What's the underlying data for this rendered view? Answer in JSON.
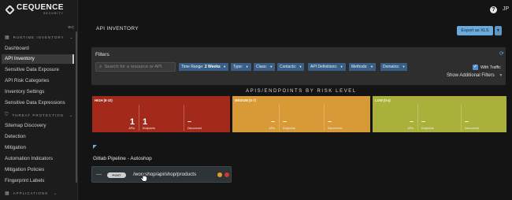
{
  "brand": {
    "name": "CEQUENCE",
    "sub": "SECURITY"
  },
  "sidebar": {
    "sections": [
      {
        "label": "RUNTIME INVENTORY"
      },
      {
        "label": "THREAT PROTECTION"
      },
      {
        "label": "APPLICATIONS"
      }
    ],
    "inventory_items": [
      {
        "label": "Dashboard"
      },
      {
        "label": "API Inventory",
        "active": true
      },
      {
        "label": "Sensitive Data Exposure"
      },
      {
        "label": "API Risk Categories"
      },
      {
        "label": "Inventory Settings"
      },
      {
        "label": "Sensitive Data Expressions"
      }
    ],
    "threat_items": [
      {
        "label": "Sitemap Discovery"
      },
      {
        "label": "Detection"
      },
      {
        "label": "Mitigation"
      },
      {
        "label": "Automation Indicators"
      },
      {
        "label": "Mitigation Policies"
      },
      {
        "label": "Fingerprint Labels"
      }
    ]
  },
  "header": {
    "user_initials": "JP",
    "help_glyph": "?"
  },
  "page": {
    "title": "API INVENTORY",
    "export_label": "Export as XLS"
  },
  "filters": {
    "title": "Filters",
    "search_placeholder": "Search for a resource or API",
    "chips": [
      {
        "label": "Time Range:",
        "value": "2 Weeks"
      },
      {
        "label": "Type:",
        "value": ""
      },
      {
        "label": "Class:",
        "value": ""
      },
      {
        "label": "Contacts:",
        "value": ""
      },
      {
        "label": "API Definitions:",
        "value": ""
      },
      {
        "label": "Methods:",
        "value": ""
      },
      {
        "label": "Domains:",
        "value": ""
      }
    ],
    "with_traffic_label": "With Traffic",
    "with_traffic_checked": true,
    "show_additional_label": "Show Additional Filters"
  },
  "risk": {
    "heading": "APIS/ENDPOINTS BY RISK LEVEL",
    "cards": [
      {
        "level": "high",
        "label": "HIGH (8-10)",
        "apis": "1",
        "endpoints": "1",
        "discovered": "–",
        "apis_label": "APIs",
        "endpoints_label": "Endpoints",
        "discovered_label": "Discovered"
      },
      {
        "level": "medium",
        "label": "MEDIUM (5-7)",
        "apis": "–",
        "endpoints": "–",
        "discovered": "–",
        "apis_label": "APIs",
        "endpoints_label": "Endpoints",
        "discovered_label": "Discovered"
      },
      {
        "level": "low",
        "label": "LOW (0-4)",
        "apis": "–",
        "endpoints": "–",
        "discovered": "–",
        "apis_label": "APIs",
        "endpoints_label": "Endpoints",
        "discovered_label": "Discovered"
      }
    ]
  },
  "pipeline": {
    "title": "Gitlab Pipeline - Autoshop",
    "endpoint": {
      "dash": "—",
      "method": "POST",
      "path": "/workshop/api/shop/products"
    }
  },
  "colors": {
    "high": "#a32a1b",
    "medium": "#d79a36",
    "low": "#a9b13a",
    "accent": "#6aa9d9",
    "chip": "#3a5f86"
  }
}
